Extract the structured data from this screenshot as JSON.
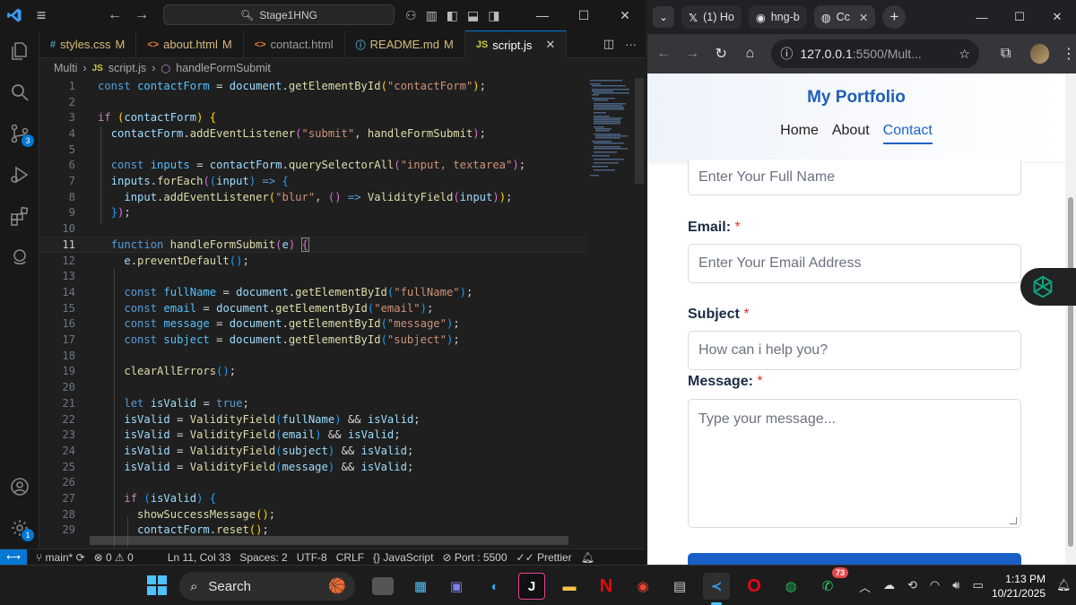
{
  "vscode": {
    "search_text": "Stage1HNG",
    "tabs": [
      {
        "icon": "#",
        "label": "styles.css",
        "modified": "M"
      },
      {
        "icon": "<>",
        "label": "about.html",
        "modified": "M"
      },
      {
        "icon": "<>",
        "label": "contact.html",
        "modified": ""
      },
      {
        "icon": "ⓘ",
        "label": "README.md",
        "modified": "M"
      },
      {
        "icon": "JS",
        "label": "script.js",
        "modified": ""
      }
    ],
    "breadcrumb": {
      "folder": "Multi",
      "file": "script.js",
      "symbol": "handleFormSubmit"
    },
    "activity_badges": {
      "source_control": "3",
      "settings": "1"
    },
    "code_lines": [
      "const contactForm = document.getElementById(\"contactForm\");",
      "",
      "if (contactForm) {",
      "  contactForm.addEventListener(\"submit\", handleFormSubmit);",
      "",
      "  const inputs = contactForm.querySelectorAll(\"input, textarea\");",
      "  inputs.forEach((input) => {",
      "    input.addEventListener(\"blur\", () => ValidityField(input));",
      "  });",
      "",
      "  function handleFormSubmit(e) {",
      "    e.preventDefault();",
      "",
      "    const fullName = document.getElementById(\"fullName\");",
      "    const email = document.getElementById(\"email\");",
      "    const message = document.getElementById(\"message\");",
      "    const subject = document.getElementById(\"subject\");",
      "",
      "    clearAllErrors();",
      "",
      "    let isValid = true;",
      "    isValid = ValidityField(fullName) && isValid;",
      "    isValid = ValidityField(email) && isValid;",
      "    isValid = ValidityField(subject) && isValid;",
      "    isValid = ValidityField(message) && isValid;",
      "",
      "    if (isValid) {",
      "      showSuccessMessage();",
      "      contactForm.reset();"
    ],
    "current_line": 11,
    "status": {
      "branch": "main*",
      "errors": "0",
      "warnings": "0",
      "position": "Ln 11, Col 33",
      "spaces": "Spaces: 2",
      "encoding": "UTF-8",
      "eol": "CRLF",
      "language": "JavaScript",
      "port": "Port : 5500",
      "formatter": "Prettier"
    }
  },
  "browser": {
    "tabs": [
      {
        "label": "(1) Ho",
        "icon": "x-icon"
      },
      {
        "label": "hng-b",
        "icon": "github-icon"
      },
      {
        "label": "Cc",
        "icon": "globe-icon"
      }
    ],
    "url_host": "127.0.0.1",
    "url_rest": ":5500/Mult...",
    "page": {
      "site_title": "My Portfolio",
      "nav": [
        "Home",
        "About",
        "Contact"
      ],
      "active_nav": "Contact",
      "fullname_placeholder": "Enter Your Full Name",
      "email_label": "Email:",
      "email_placeholder": "Enter Your Email Address",
      "subject_label": "Subject",
      "subject_placeholder": "How can i help you?",
      "message_label": "Message:",
      "message_placeholder": "Type your message...",
      "required_mark": "*"
    }
  },
  "taskbar": {
    "search_label": "Search",
    "whatsapp_badge": "73",
    "time": "1:13 PM",
    "date": "10/21/2025"
  }
}
